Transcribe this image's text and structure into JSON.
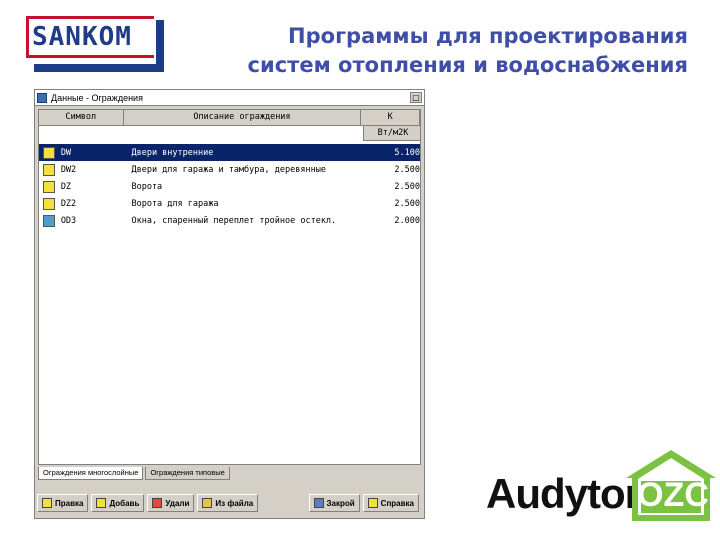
{
  "slide": {
    "logo_text": "SANKOM",
    "title_line1": "Программы для проектирования",
    "title_line2": "систем отопления и водоснабжения",
    "colors": {
      "title": "#3f4ea6",
      "logo_blue": "#1f3c88",
      "logo_red": "#c8102e",
      "ozc_green": "#7bc142"
    }
  },
  "window": {
    "title": "Данные - Ограждения",
    "columns": {
      "symbol": "Символ",
      "description": "Описание ограждения",
      "k": "K",
      "k_unit": "Вт/м2К"
    },
    "rows": [
      {
        "icon": "door-icon",
        "symbol": "DW",
        "description": "Двери внутренние",
        "k": "5.100"
      },
      {
        "icon": "door-icon",
        "symbol": "DW2",
        "description": "Двери для гаража и тамбура, деревянные",
        "k": "2.500"
      },
      {
        "icon": "door-icon",
        "symbol": "DZ",
        "description": "Ворота",
        "k": "2.500"
      },
      {
        "icon": "door-icon",
        "symbol": "DZ2",
        "description": "Ворота для гаража",
        "k": "2.500"
      },
      {
        "icon": "window-icon",
        "symbol": "OD3",
        "description": "Окна, спаренный переплет тройное остекл.",
        "k": "2.000"
      }
    ],
    "tabs": [
      "Ограждения многослойные",
      "Ограждения типовые"
    ],
    "toolbar": {
      "edit": "Правка",
      "add": "Добавь",
      "delete": "Удали",
      "from_file": "Из файла",
      "close": "Закрой",
      "help": "Справка"
    }
  },
  "brand": {
    "audytor": "Audytor",
    "ozc": "OZC"
  }
}
